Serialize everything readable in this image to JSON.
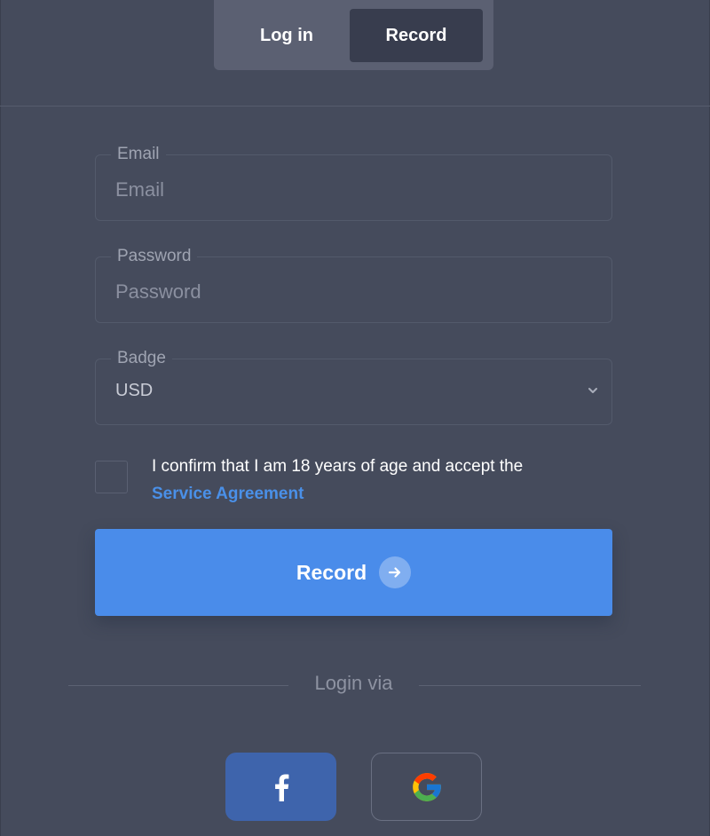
{
  "tabs": {
    "login_label": "Log in",
    "record_label": "Record"
  },
  "form": {
    "email": {
      "legend": "Email",
      "placeholder": "Email",
      "value": ""
    },
    "password": {
      "legend": "Password",
      "placeholder": "Password",
      "value": ""
    },
    "badge": {
      "legend": "Badge",
      "selected": "USD"
    },
    "agreement": {
      "checked": false,
      "text": "I confirm that I am 18 years of age and accept the",
      "link_text": "Service Agreement"
    },
    "submit_label": "Record",
    "submit_icon": "arrow-right-icon"
  },
  "social": {
    "divider_text": "Login via",
    "providers": [
      {
        "name": "facebook",
        "icon": "facebook-icon"
      },
      {
        "name": "google",
        "icon": "google-icon"
      }
    ]
  },
  "colors": {
    "background": "#454b5c",
    "accent": "#4a8cea",
    "link": "#4a90e8",
    "facebook": "#3e64ac"
  }
}
